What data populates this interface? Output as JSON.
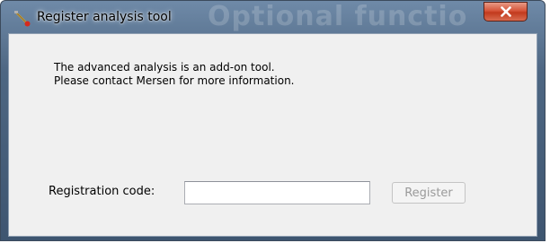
{
  "window": {
    "title": "Register analysis tool",
    "background_watermark": "Optional functio",
    "close_icon": "close-x-icon",
    "app_icon": "wrench-tool-icon",
    "close_button_color": "#c9482b",
    "titlebar_color": "#4d6682"
  },
  "message": {
    "line1": "The advanced analysis is an add-on tool.",
    "line2": "Please contact Mersen for more information."
  },
  "registration": {
    "label": "Registration code:",
    "input_value": "",
    "input_placeholder": "",
    "button_label": "Register",
    "button_enabled": false
  }
}
